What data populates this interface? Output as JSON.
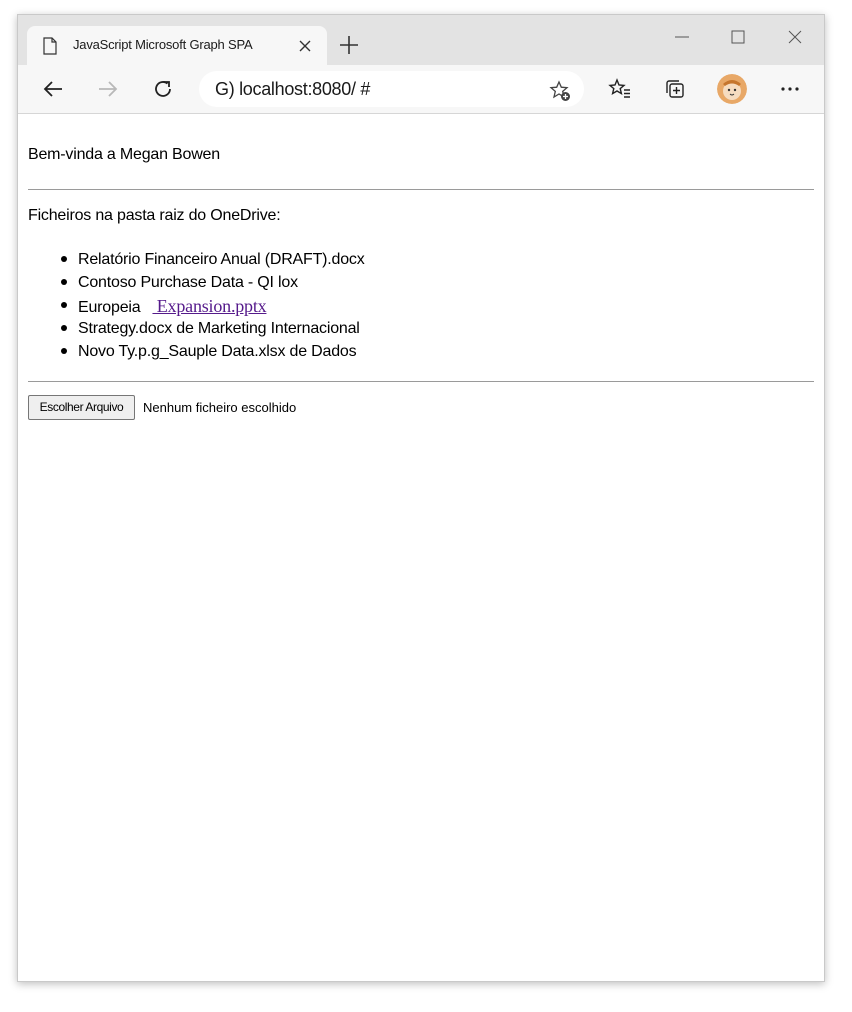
{
  "browser": {
    "tab": {
      "title": "JavaScript Microsoft Graph SPA",
      "favicon": "document-icon"
    },
    "address": {
      "url": "G) localhost:8080/ #"
    },
    "icons": [
      "back-arrow-icon",
      "forward-arrow-icon",
      "refresh-icon",
      "add-favorite-icon",
      "favorites-icon",
      "collections-icon",
      "more-icon",
      "minimize-icon",
      "maximize-icon",
      "close-icon",
      "new-tab-icon"
    ]
  },
  "page": {
    "welcome": "Bem-vinda a Megan Bowen",
    "files_heading": "Ficheiros na pasta raiz do OneDrive:",
    "files": [
      {
        "name": "Relatório Financeiro Anual (DRAFT).docx"
      },
      {
        "name": "Contoso Purchase Data - QI lox"
      },
      {
        "name": "Europeia",
        "link": " Expansion.pptx"
      },
      {
        "name": "Strategy.docx de Marketing Internacional"
      },
      {
        "name": "Novo Ty.p.g_Sauple Data.xlsx de Dados"
      }
    ],
    "file_input": {
      "button": "Escolher Arquivo",
      "status": "Nenhum ficheiro escolhido"
    }
  },
  "colors": {
    "tabstrip": "#e3e3e3",
    "toolbar": "#f7f7f7",
    "link_visited": "#551a8b"
  }
}
